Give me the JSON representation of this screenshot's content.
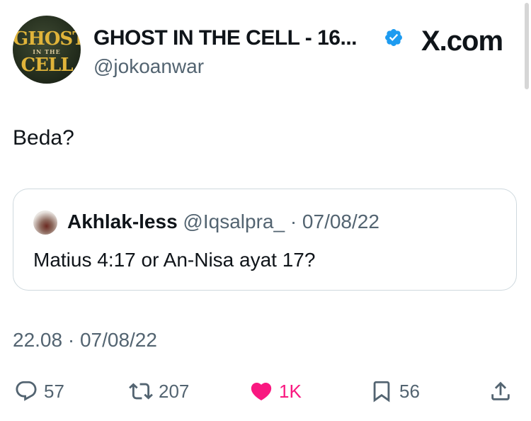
{
  "author": {
    "display_name": "GHOST IN THE CELL - 16...",
    "handle": "@jokoanwar",
    "verified": true,
    "avatar_text": [
      "GHOST",
      "IN THE",
      "CELL"
    ]
  },
  "brand": "X.com",
  "tweet": {
    "text": "Beda?"
  },
  "quoted": {
    "name": "Akhlak-less",
    "handle": "@Iqsalpra_",
    "separator": "·",
    "date": "07/08/22",
    "text": "Matius 4:17 or An-Nisa ayat 17?"
  },
  "timestamp": "22.08 · 07/08/22",
  "actions": {
    "replies": "57",
    "retweets": "207",
    "likes": "1K",
    "bookmarks": "56"
  },
  "colors": {
    "accent": "#1d9bf0",
    "like": "#f91880",
    "muted": "#536471",
    "border": "#cfd9de"
  }
}
